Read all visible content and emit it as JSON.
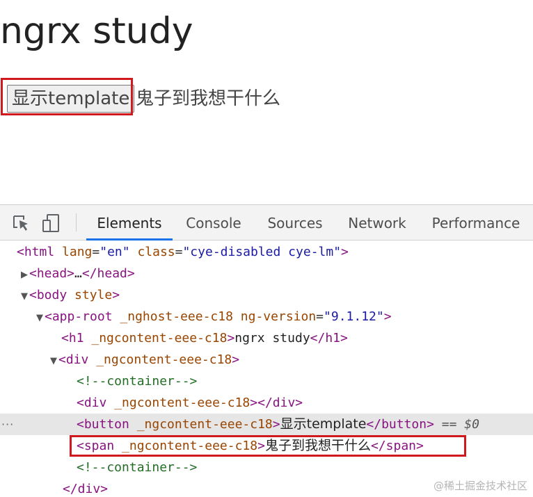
{
  "page": {
    "title": "ngrx study",
    "button_label": "显示template",
    "ghost_text": "鬼子到我想干什么"
  },
  "devtools": {
    "tabs": [
      "Elements",
      "Console",
      "Sources",
      "Network",
      "Performance"
    ],
    "active_tab": "Elements",
    "tree": {
      "html_open": "<html",
      "html_lang_attr": "lang",
      "html_lang_val": "\"en\"",
      "html_class_attr": "class",
      "html_class_val": "\"cye-disabled cye-lm\"",
      "tag_close": ">",
      "head_open": "<head>",
      "ellipsis": "…",
      "head_close": "</head>",
      "body_open": "<body",
      "body_attr": "style",
      "approot_open": "<app-root",
      "approot_attr1": "_nghost-eee-c18",
      "approot_attr2": "ng-version",
      "approot_val2": "\"9.1.12\"",
      "h1_open": "<h1",
      "h1_attr": "_ngcontent-eee-c18",
      "h1_text": "ngrx study",
      "h1_close": "</h1>",
      "div_open": "<div",
      "div_attr": "_ngcontent-eee-c18",
      "comment": "<!--container-->",
      "div2_open": "<div",
      "div2_attr": "_ngcontent-eee-c18",
      "div2_close": "></div>",
      "button_open": "<button",
      "button_attr": "_ngcontent-eee-c18",
      "button_text": "显示template",
      "button_close": "</button>",
      "selected_marker": "== $0",
      "span_open": "<span",
      "span_attr": "_ngcontent-eee-c18",
      "span_text": "鬼子到我想干什么",
      "span_close": "</span>",
      "comment2": "<!--container-->",
      "div_close": "</div>",
      "dots": "···"
    }
  },
  "watermark": "@稀土掘金技术社区",
  "colors": {
    "highlight": "#d0191f",
    "tab_active_underline": "#1a73e8",
    "tag": "#881280",
    "attr": "#994500",
    "value": "#1a1aa6",
    "comment": "#236e25"
  },
  "icons": [
    "inspect-element-icon",
    "device-toolbar-icon",
    "expand-triangle-icon",
    "collapse-triangle-icon"
  ]
}
